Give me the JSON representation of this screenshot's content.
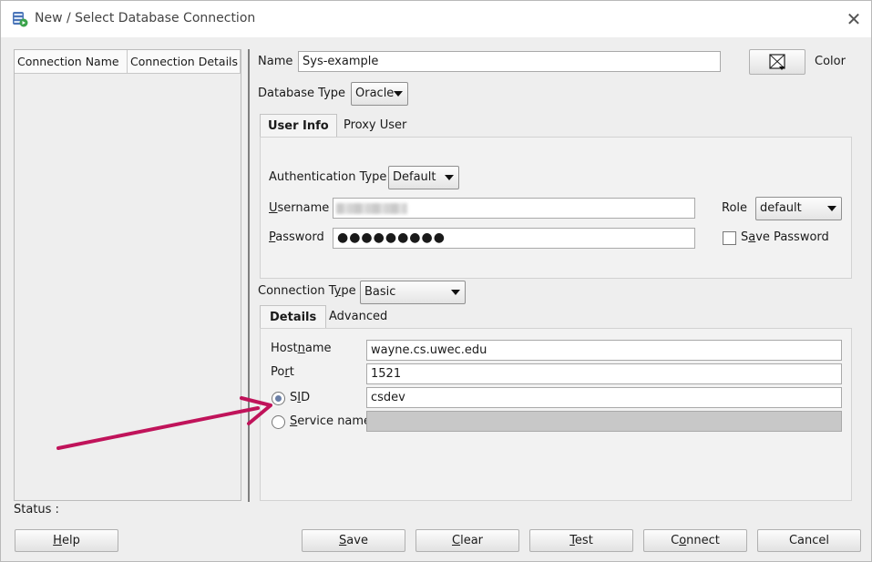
{
  "window": {
    "title": "New / Select Database Connection"
  },
  "connections_table": {
    "columns": [
      "Connection Name",
      "Connection Details"
    ]
  },
  "name": {
    "label": "Name",
    "value": "Sys-example"
  },
  "color": {
    "label": "Color"
  },
  "database_type": {
    "label": "Database Type",
    "value": "Oracle"
  },
  "tabs_top": [
    {
      "label": "User Info",
      "active": true
    },
    {
      "label": "Proxy User",
      "active": false
    }
  ],
  "user_info": {
    "auth_label": "Authentication Type",
    "auth_value": "Default",
    "username_label": "Username",
    "password_label": "Password",
    "password_value": "●●●●●●●●●",
    "role_label": "Role",
    "role_value": "default",
    "save_password_label": "Save Password",
    "save_password_checked": false
  },
  "connection_type": {
    "label": "Connection Type",
    "value": "Basic"
  },
  "tabs_details": [
    {
      "label": "Details",
      "active": true
    },
    {
      "label": "Advanced",
      "active": false
    }
  ],
  "details": {
    "hostname_label": "Hostname",
    "hostname_value": "wayne.cs.uwec.edu",
    "port_label": "Port",
    "port_value": "1521",
    "sid_label": "SID",
    "sid_value": "csdev",
    "sid_selected": true,
    "service_label": "Service name",
    "service_value": ""
  },
  "status": {
    "label": "Status :"
  },
  "buttons": {
    "help": "Help",
    "save": "Save",
    "clear": "Clear",
    "test": "Test",
    "connect": "Connect",
    "cancel": "Cancel"
  },
  "annotation": {
    "arrow_color": "#c0135a"
  },
  "colors": {
    "window_bg": "#eeeeee",
    "titlebar_bg": "#ffffff",
    "radio_dot": "#6a7fa6"
  }
}
